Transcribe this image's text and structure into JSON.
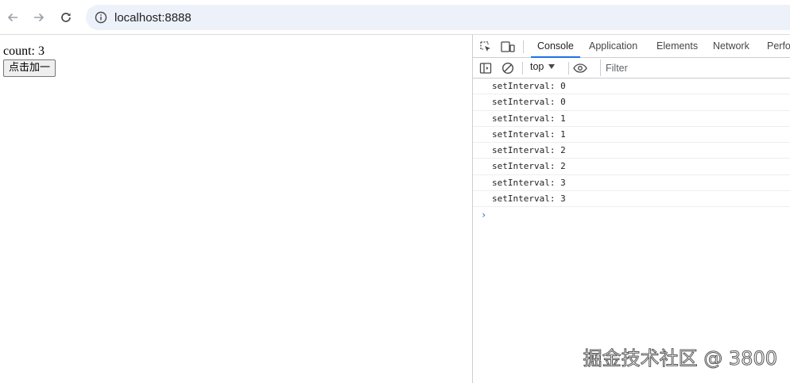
{
  "browser": {
    "url": "localhost:8888",
    "icons": {
      "back": "arrow-left-icon",
      "forward": "arrow-right-icon",
      "reload": "reload-icon",
      "site_info": "info-icon"
    }
  },
  "page": {
    "count_text": "count: 3",
    "button_label": "点击加一"
  },
  "devtools": {
    "tabs": [
      {
        "label": "Console",
        "active": true
      },
      {
        "label": "Application",
        "active": false
      },
      {
        "label": "Elements",
        "active": false
      },
      {
        "label": "Network",
        "active": false
      },
      {
        "label": "Perfo",
        "active": false
      }
    ],
    "toolbar": {
      "context": "top",
      "filter_placeholder": "Filter"
    },
    "logs": [
      "setInterval: 0",
      "setInterval: 0",
      "setInterval: 1",
      "setInterval: 1",
      "setInterval: 2",
      "setInterval: 2",
      "setInterval: 3",
      "setInterval: 3"
    ],
    "prompt": "›",
    "accent_color": "#1a73e8"
  },
  "watermark": "掘金技术社区 @ 3800"
}
